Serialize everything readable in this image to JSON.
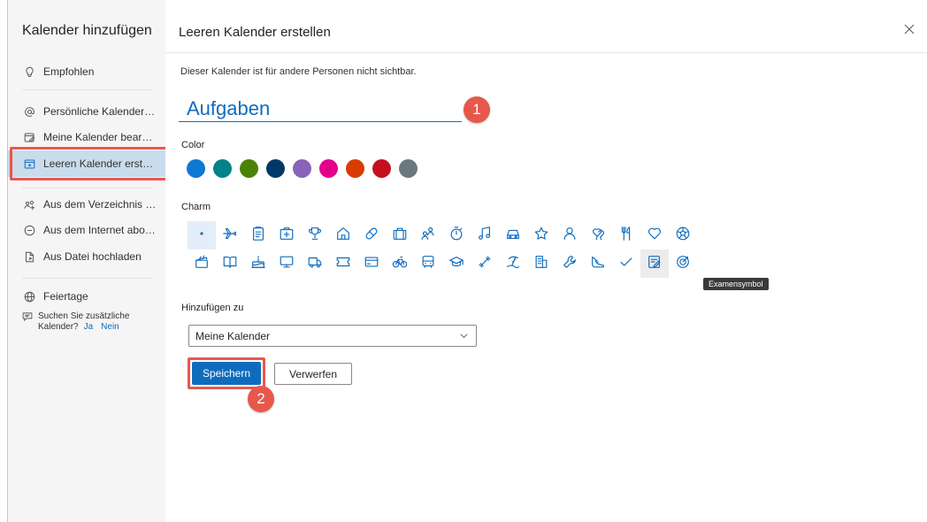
{
  "sidebar": {
    "title": "Kalender hinzufügen",
    "items": [
      {
        "label": "Empfohlen",
        "icon": "lightbulb-icon"
      },
      {
        "label": "Persönliche Kalender hi...",
        "icon": "at-sign-icon"
      },
      {
        "label": "Meine Kalender bearbei...",
        "icon": "edit-calendar-icon"
      },
      {
        "label": "Leeren Kalender erstell...",
        "icon": "calendar-add-icon",
        "selected": true
      },
      {
        "label": "Aus dem Verzeichnis hi...",
        "icon": "people-search-icon"
      },
      {
        "label": "Aus dem Internet abon...",
        "icon": "web-subscribe-icon"
      },
      {
        "label": "Aus Datei hochladen",
        "icon": "file-upload-icon"
      },
      {
        "label": "Feiertage",
        "icon": "globe-icon"
      }
    ],
    "suggest": {
      "line1": "Suchen Sie zusätzliche",
      "line2": "Kalender?",
      "yes": "Ja",
      "no": "Nein"
    }
  },
  "main": {
    "title": "Leeren Kalender erstellen",
    "description": "Dieser Kalender ist für andere Personen nicht sichtbar.",
    "name_value": "Aufgaben",
    "color_label": "Color",
    "colors": [
      "#0f78d4",
      "#038387",
      "#498205",
      "#003966",
      "#8764b8",
      "#e3008c",
      "#da3b01",
      "#c50f1f",
      "#69797e"
    ],
    "charm_label": "Charm",
    "charm_tooltip": "Examensymbol",
    "add_to_label": "Hinzufügen zu",
    "add_to_value": "Meine Kalender",
    "save_label": "Speichern",
    "discard_label": "Verwerfen"
  },
  "annotations": {
    "badge1": "1",
    "badge2": "2"
  },
  "charm_rows": [
    [
      "dot-icon",
      "airplane-icon",
      "clipboard-icon",
      "first-aid-icon",
      "trophy-icon",
      "home-icon",
      "pill-icon",
      "briefcase-icon",
      "people-icon",
      "stopwatch-icon",
      "music-note-icon",
      "car-icon",
      "star-icon",
      "person-icon",
      "heart-balloon-icon",
      "fork-knife-icon",
      "heart-icon",
      "soccer-ball-icon"
    ],
    [
      "clapperboard-icon",
      "book-icon",
      "birthday-cake-icon",
      "monitor-icon",
      "truck-icon",
      "ticket-icon",
      "credit-card-icon",
      "bicycle-icon",
      "bus-icon",
      "graduation-cap-icon",
      "dumbbell-icon",
      "beach-icon",
      "building-icon",
      "wrench-icon",
      "running-shoe-icon",
      "checkmark-icon",
      "exam-edit-icon",
      "target-icon"
    ]
  ]
}
